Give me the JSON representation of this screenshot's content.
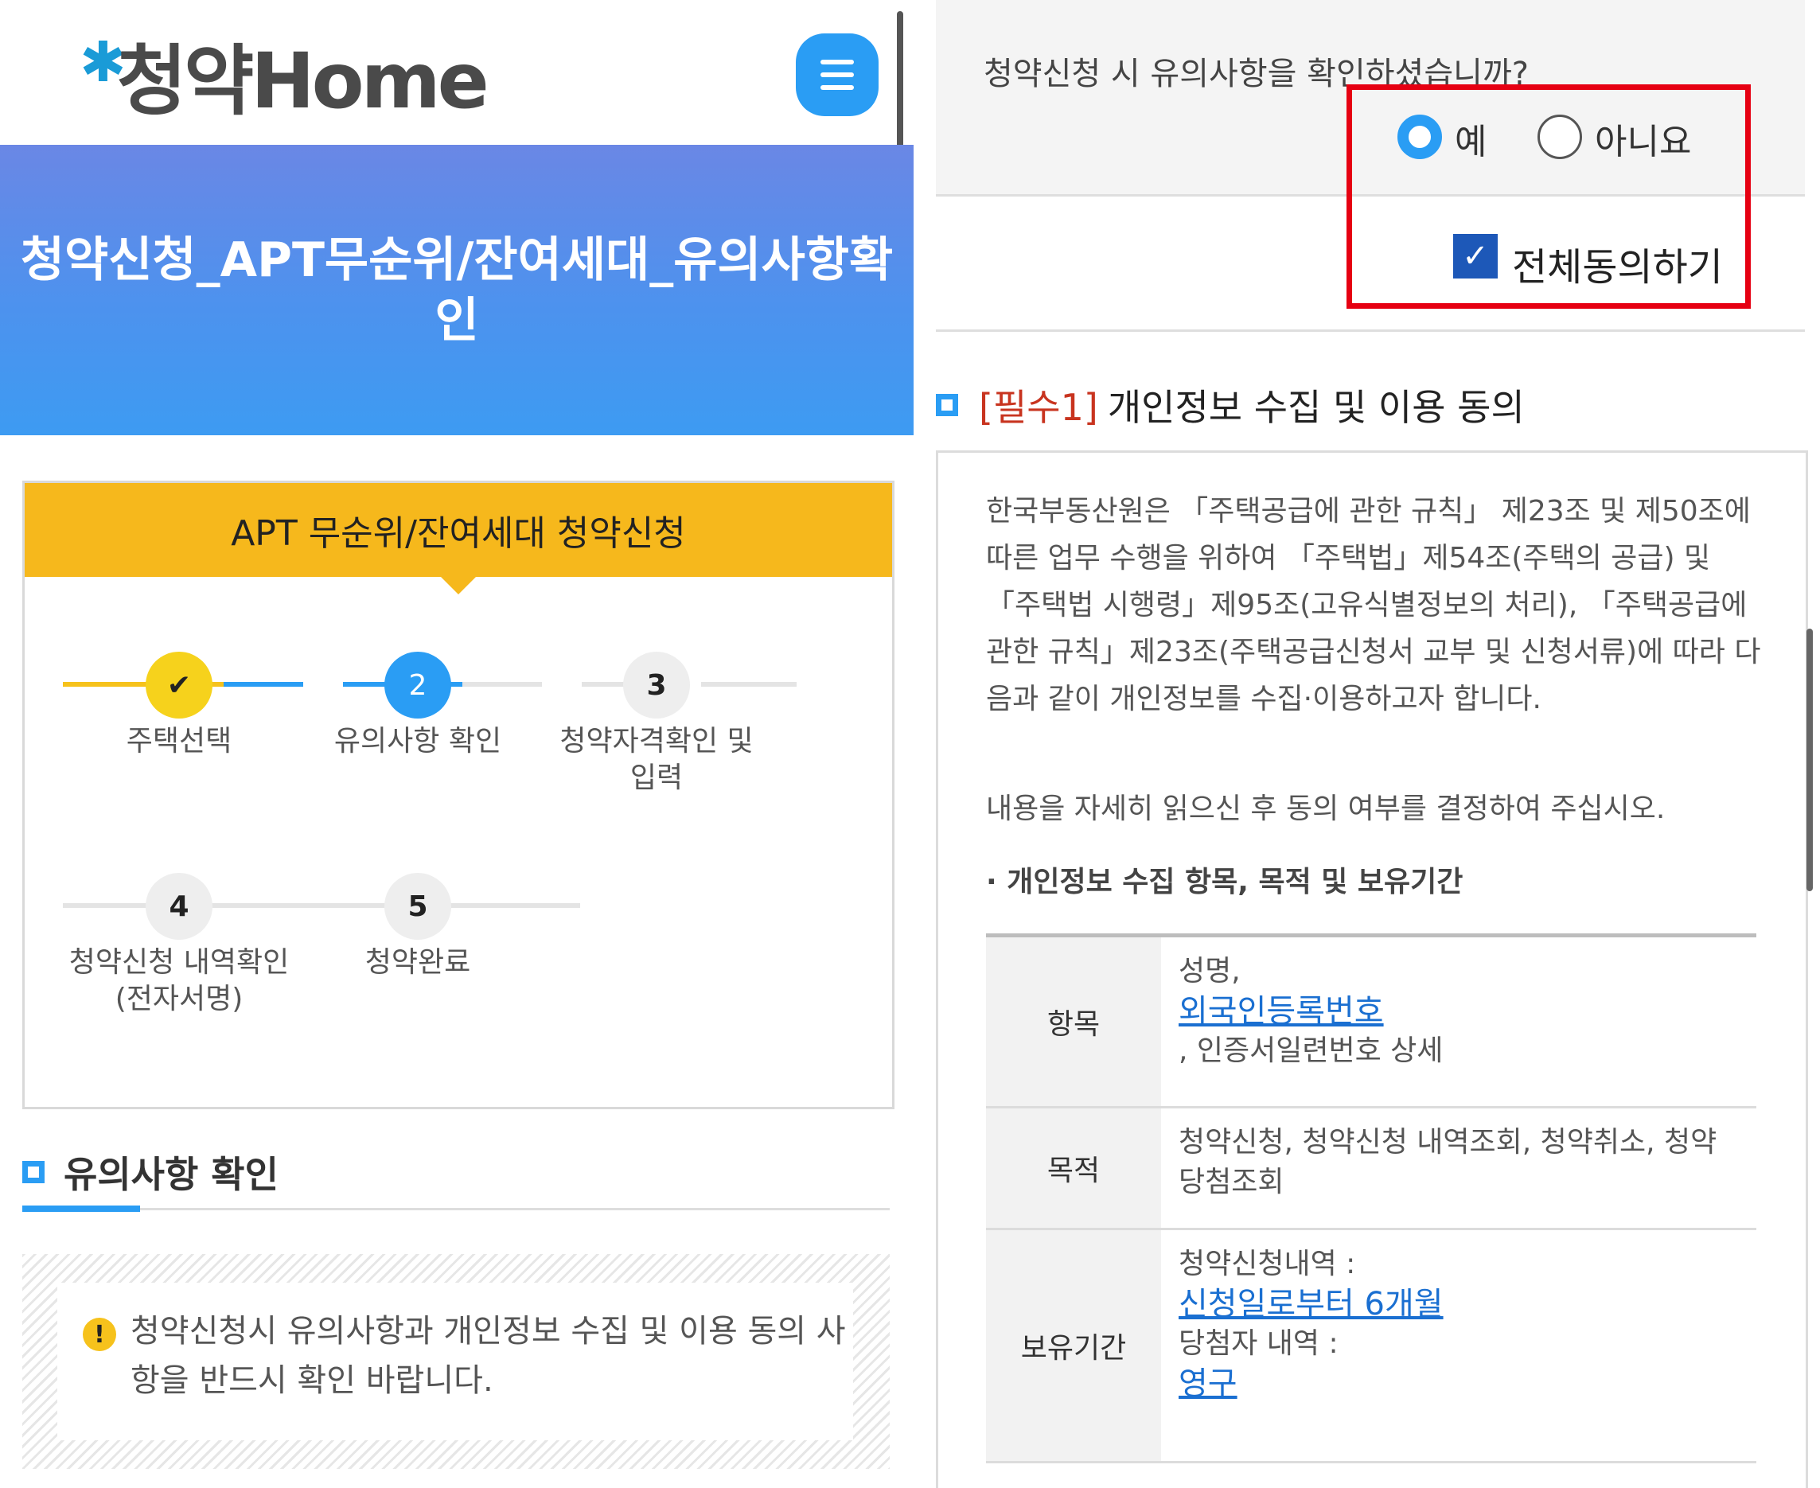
{
  "header": {
    "logo_text": "청약Home",
    "menu_icon": "hamburger-icon"
  },
  "banner": {
    "title": "청약신청_APT무순위/잔여세대_유의사항확인"
  },
  "apt_box": {
    "title": "APT 무순위/잔여세대 청약신청"
  },
  "steps": [
    {
      "number": "✔",
      "label": "주택선택",
      "status": "done"
    },
    {
      "number": "2",
      "label": "유의사항 확인",
      "status": "current"
    },
    {
      "number": "3",
      "label": "청약자격확인 및 입력",
      "status": "pending"
    },
    {
      "number": "4",
      "label": "청약신청 내역확인(전자서명)",
      "status": "pending"
    },
    {
      "number": "5",
      "label": "청약완료",
      "status": "pending"
    }
  ],
  "notice_section": {
    "title": "유의사항 확인",
    "notice_icon": "exclamation-icon",
    "notice_text": "청약신청시 유의사항과 개인정보 수집 및 이용 동의 사항을 반드시 확인 바랍니다."
  },
  "confirm": {
    "question": "청약신청 시 유의사항을 확인하셨습니까?",
    "yes_label": "예",
    "no_label": "아니요",
    "selected": "예",
    "agree_all_label": "전체동의하기",
    "agree_all_checked": true
  },
  "required1": {
    "tag": "[필수1]",
    "title": "개인정보 수집 및 이용 동의",
    "para1": "한국부동산원은 「주택공급에 관한 규칙」 제23조 및 제50조에 따른 업무 수행을 위하여 「주택법」제54조(주택의 공급) 및 「주택법 시행령」제95조(고유식별정보의 처리), 「주택공급에 관한 규칙」제23조(주택공급신청서 교부 및 신청서류)에 따라 다음과 같이 개인정보를 수집·이용하고자 합니다.",
    "para2": "내용을 자세히 읽으신 후 동의 여부를 결정하여 주십시오.",
    "list_heading": "· 개인정보 수집 항목, 목적 및 보유기간",
    "table": {
      "row1_header": "항목",
      "row1_text_a": "성명,",
      "row1_link": "외국인등록번호",
      "row1_text_b": ", 인증서일련번호 상세",
      "row2_header": "목적",
      "row2_text": "청약신청, 청약신청 내역조회, 청약취소, 청약당첨조회",
      "row3_header": "보유기간",
      "row3_text_a": "청약신청내역 :",
      "row3_link_a": "신청일로부터 6개월",
      "row3_text_b": "당첨자 내역 :",
      "row3_link_b": "영구"
    }
  },
  "colors": {
    "primary_blue": "#2a9df4",
    "accent_yellow": "#f6b81c",
    "highlight_red": "#e60012",
    "required_red": "#c8341f",
    "link_blue": "#1a6fd1"
  }
}
